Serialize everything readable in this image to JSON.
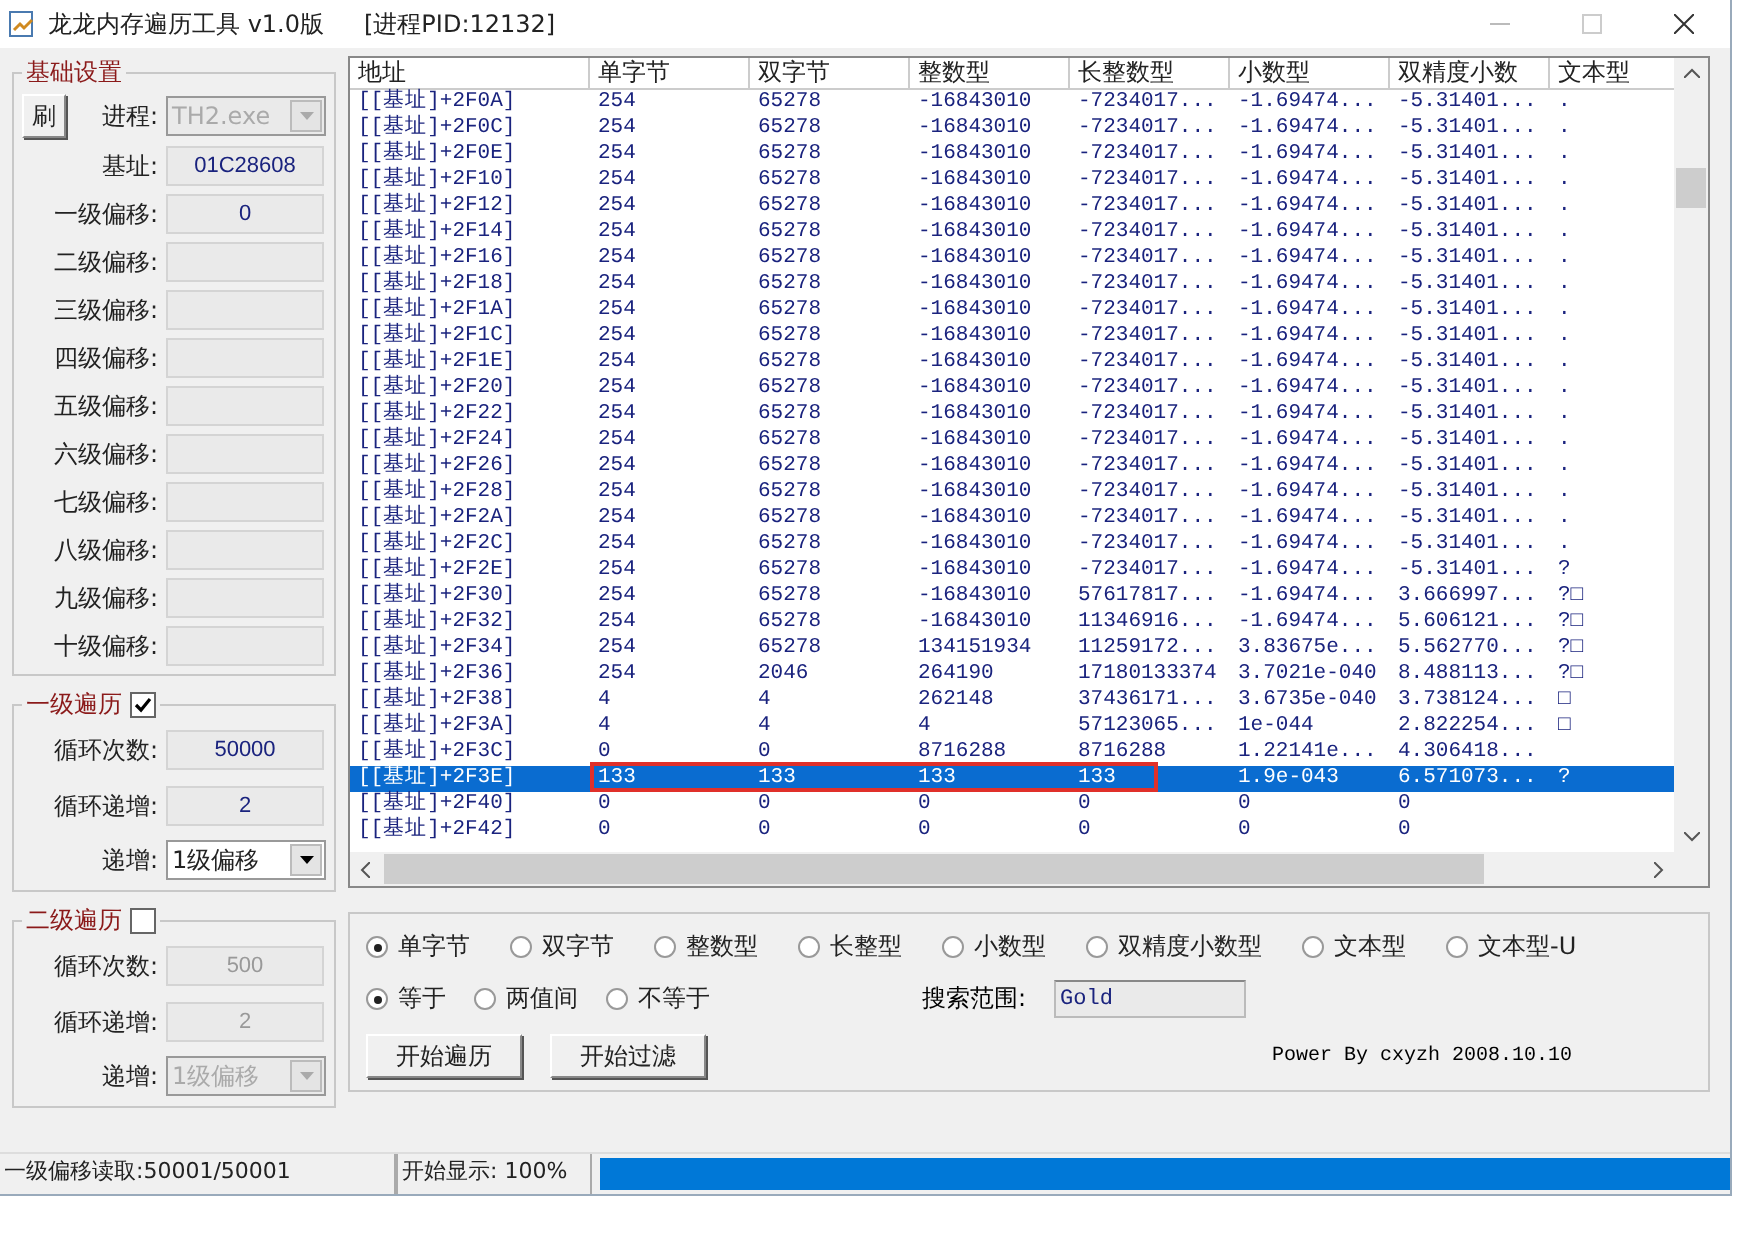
{
  "window": {
    "title": "龙龙内存遍历工具 v1.0版",
    "pid": "[进程PID:12132]"
  },
  "basic_settings": {
    "title": "基础设置",
    "refresh_button": "刷",
    "process_label": "进程:",
    "process_value": "TH2.exe",
    "fields": [
      {
        "label": "基址:",
        "value": "01C28608"
      },
      {
        "label": "一级偏移:",
        "value": "0"
      },
      {
        "label": "二级偏移:"
      },
      {
        "label": "三级偏移:"
      },
      {
        "label": "四级偏移:"
      },
      {
        "label": "五级偏移:"
      },
      {
        "label": "六级偏移:"
      },
      {
        "label": "七级偏移:"
      },
      {
        "label": "八级偏移:"
      },
      {
        "label": "九级偏移:"
      },
      {
        "label": "十级偏移:"
      }
    ]
  },
  "traversals": [
    {
      "title": "一级遍历",
      "checked": true,
      "fields": [
        {
          "label": "循环次数:",
          "value": "50000"
        },
        {
          "label": "循环递增:",
          "value": "2"
        }
      ],
      "step_label": "递增:",
      "step_value": "1级偏移"
    },
    {
      "title": "二级遍历",
      "checked": false,
      "fields": [
        {
          "label": "循环次数:",
          "value": "500"
        },
        {
          "label": "循环递增:",
          "value": "2"
        }
      ],
      "step_label": "递增:",
      "step_value": "1级偏移"
    }
  ],
  "table": {
    "columns": [
      "地址",
      "单字节",
      "双字节",
      "整数型",
      "长整数型",
      "小数型",
      "双精度小数",
      "文本型"
    ],
    "rows": [
      {
        "address": "[[基址]+2F0A]",
        "byte": "254",
        "word": "65278",
        "int": "-16843010",
        "long": "-7234017...",
        "float": "-1.69474...",
        "double": "-5.31401...",
        "text": ".",
        "selected": false,
        "marked": false
      },
      {
        "address": "[[基址]+2F0C]",
        "byte": "254",
        "word": "65278",
        "int": "-16843010",
        "long": "-7234017...",
        "float": "-1.69474...",
        "double": "-5.31401...",
        "text": ".",
        "selected": false,
        "marked": false
      },
      {
        "address": "[[基址]+2F0E]",
        "byte": "254",
        "word": "65278",
        "int": "-16843010",
        "long": "-7234017...",
        "float": "-1.69474...",
        "double": "-5.31401...",
        "text": ".",
        "selected": false,
        "marked": false
      },
      {
        "address": "[[基址]+2F10]",
        "byte": "254",
        "word": "65278",
        "int": "-16843010",
        "long": "-7234017...",
        "float": "-1.69474...",
        "double": "-5.31401...",
        "text": ".",
        "selected": false,
        "marked": false
      },
      {
        "address": "[[基址]+2F12]",
        "byte": "254",
        "word": "65278",
        "int": "-16843010",
        "long": "-7234017...",
        "float": "-1.69474...",
        "double": "-5.31401...",
        "text": ".",
        "selected": false,
        "marked": false
      },
      {
        "address": "[[基址]+2F14]",
        "byte": "254",
        "word": "65278",
        "int": "-16843010",
        "long": "-7234017...",
        "float": "-1.69474...",
        "double": "-5.31401...",
        "text": ".",
        "selected": false,
        "marked": false
      },
      {
        "address": "[[基址]+2F16]",
        "byte": "254",
        "word": "65278",
        "int": "-16843010",
        "long": "-7234017...",
        "float": "-1.69474...",
        "double": "-5.31401...",
        "text": ".",
        "selected": false,
        "marked": false
      },
      {
        "address": "[[基址]+2F18]",
        "byte": "254",
        "word": "65278",
        "int": "-16843010",
        "long": "-7234017...",
        "float": "-1.69474...",
        "double": "-5.31401...",
        "text": ".",
        "selected": false,
        "marked": false
      },
      {
        "address": "[[基址]+2F1A]",
        "byte": "254",
        "word": "65278",
        "int": "-16843010",
        "long": "-7234017...",
        "float": "-1.69474...",
        "double": "-5.31401...",
        "text": ".",
        "selected": false,
        "marked": false
      },
      {
        "address": "[[基址]+2F1C]",
        "byte": "254",
        "word": "65278",
        "int": "-16843010",
        "long": "-7234017...",
        "float": "-1.69474...",
        "double": "-5.31401...",
        "text": ".",
        "selected": false,
        "marked": false
      },
      {
        "address": "[[基址]+2F1E]",
        "byte": "254",
        "word": "65278",
        "int": "-16843010",
        "long": "-7234017...",
        "float": "-1.69474...",
        "double": "-5.31401...",
        "text": ".",
        "selected": false,
        "marked": false
      },
      {
        "address": "[[基址]+2F20]",
        "byte": "254",
        "word": "65278",
        "int": "-16843010",
        "long": "-7234017...",
        "float": "-1.69474...",
        "double": "-5.31401...",
        "text": ".",
        "selected": false,
        "marked": false
      },
      {
        "address": "[[基址]+2F22]",
        "byte": "254",
        "word": "65278",
        "int": "-16843010",
        "long": "-7234017...",
        "float": "-1.69474...",
        "double": "-5.31401...",
        "text": ".",
        "selected": false,
        "marked": false
      },
      {
        "address": "[[基址]+2F24]",
        "byte": "254",
        "word": "65278",
        "int": "-16843010",
        "long": "-7234017...",
        "float": "-1.69474...",
        "double": "-5.31401...",
        "text": ".",
        "selected": false,
        "marked": false
      },
      {
        "address": "[[基址]+2F26]",
        "byte": "254",
        "word": "65278",
        "int": "-16843010",
        "long": "-7234017...",
        "float": "-1.69474...",
        "double": "-5.31401...",
        "text": ".",
        "selected": false,
        "marked": false
      },
      {
        "address": "[[基址]+2F28]",
        "byte": "254",
        "word": "65278",
        "int": "-16843010",
        "long": "-7234017...",
        "float": "-1.69474...",
        "double": "-5.31401...",
        "text": ".",
        "selected": false,
        "marked": false
      },
      {
        "address": "[[基址]+2F2A]",
        "byte": "254",
        "word": "65278",
        "int": "-16843010",
        "long": "-7234017...",
        "float": "-1.69474...",
        "double": "-5.31401...",
        "text": ".",
        "selected": false,
        "marked": false
      },
      {
        "address": "[[基址]+2F2C]",
        "byte": "254",
        "word": "65278",
        "int": "-16843010",
        "long": "-7234017...",
        "float": "-1.69474...",
        "double": "-5.31401...",
        "text": ".",
        "selected": false,
        "marked": false
      },
      {
        "address": "[[基址]+2F2E]",
        "byte": "254",
        "word": "65278",
        "int": "-16843010",
        "long": "-7234017...",
        "float": "-1.69474...",
        "double": "-5.31401...",
        "text": "?",
        "selected": false,
        "marked": false
      },
      {
        "address": "[[基址]+2F30]",
        "byte": "254",
        "word": "65278",
        "int": "-16843010",
        "long": "57617817...",
        "float": "-1.69474...",
        "double": "3.666997...",
        "text": "?□",
        "selected": false,
        "marked": false
      },
      {
        "address": "[[基址]+2F32]",
        "byte": "254",
        "word": "65278",
        "int": "-16843010",
        "long": "11346916...",
        "float": "-1.69474...",
        "double": "5.606121...",
        "text": "?□",
        "selected": false,
        "marked": false
      },
      {
        "address": "[[基址]+2F34]",
        "byte": "254",
        "word": "65278",
        "int": "134151934",
        "long": "11259172...",
        "float": "3.83675e...",
        "double": "5.562770...",
        "text": "?□",
        "selected": false,
        "marked": false
      },
      {
        "address": "[[基址]+2F36]",
        "byte": "254",
        "word": "2046",
        "int": "264190",
        "long": "17180133374",
        "float": "3.7021e-040",
        "double": "8.488113...",
        "text": "?□",
        "selected": false,
        "marked": false
      },
      {
        "address": "[[基址]+2F38]",
        "byte": "4",
        "word": "4",
        "int": "262148",
        "long": "37436171...",
        "float": "3.6735e-040",
        "double": "3.738124...",
        "text": "□",
        "selected": false,
        "marked": false
      },
      {
        "address": "[[基址]+2F3A]",
        "byte": "4",
        "word": "4",
        "int": "4",
        "long": "57123065...",
        "float": "1e-044",
        "double": "2.822254...",
        "text": "□",
        "selected": false,
        "marked": false
      },
      {
        "address": "[[基址]+2F3C]",
        "byte": "0",
        "word": "0",
        "int": "8716288",
        "long": "8716288",
        "float": "1.22141e...",
        "double": "4.306418...",
        "selected": false,
        "marked": false
      },
      {
        "address": "[[基址]+2F3E]",
        "byte": "133",
        "word": "133",
        "int": "133",
        "long": "133",
        "float": "1.9e-043",
        "double": "6.571073...",
        "text": "?",
        "selected": true,
        "marked": true
      },
      {
        "address": "[[基址]+2F40]",
        "byte": "0",
        "word": "0",
        "int": "0",
        "long": "0",
        "float": "0",
        "double": "0",
        "selected": false,
        "marked": false
      },
      {
        "address": "[[基址]+2F42]",
        "byte": "0",
        "word": "0",
        "int": "0",
        "long": "0",
        "float": "0",
        "double": "0",
        "selected": false,
        "marked": false
      }
    ]
  },
  "search": {
    "types": [
      {
        "label": "单字节",
        "selected": true
      },
      {
        "label": "双字节",
        "selected": false
      },
      {
        "label": "整数型",
        "selected": false
      },
      {
        "label": "长整型",
        "selected": false
      },
      {
        "label": "小数型",
        "selected": false
      },
      {
        "label": "双精度小数型",
        "selected": false
      },
      {
        "label": "文本型",
        "selected": false
      },
      {
        "label": "文本型-U",
        "selected": false
      }
    ],
    "compare": [
      {
        "label": "等于",
        "selected": true
      },
      {
        "label": "两值间",
        "selected": false
      },
      {
        "label": "不等于",
        "selected": false
      }
    ],
    "range_label": "搜索范围:",
    "range_value": "Gold",
    "buttons": [
      "开始遍历",
      "开始过滤"
    ],
    "credit": "Power By cxyzh 2008.10.10"
  },
  "status_bar": {
    "read_status": "一级偏移读取:50001/50001",
    "display": "开始显示: 100%",
    "progress": {
      "level": 1
    }
  }
}
